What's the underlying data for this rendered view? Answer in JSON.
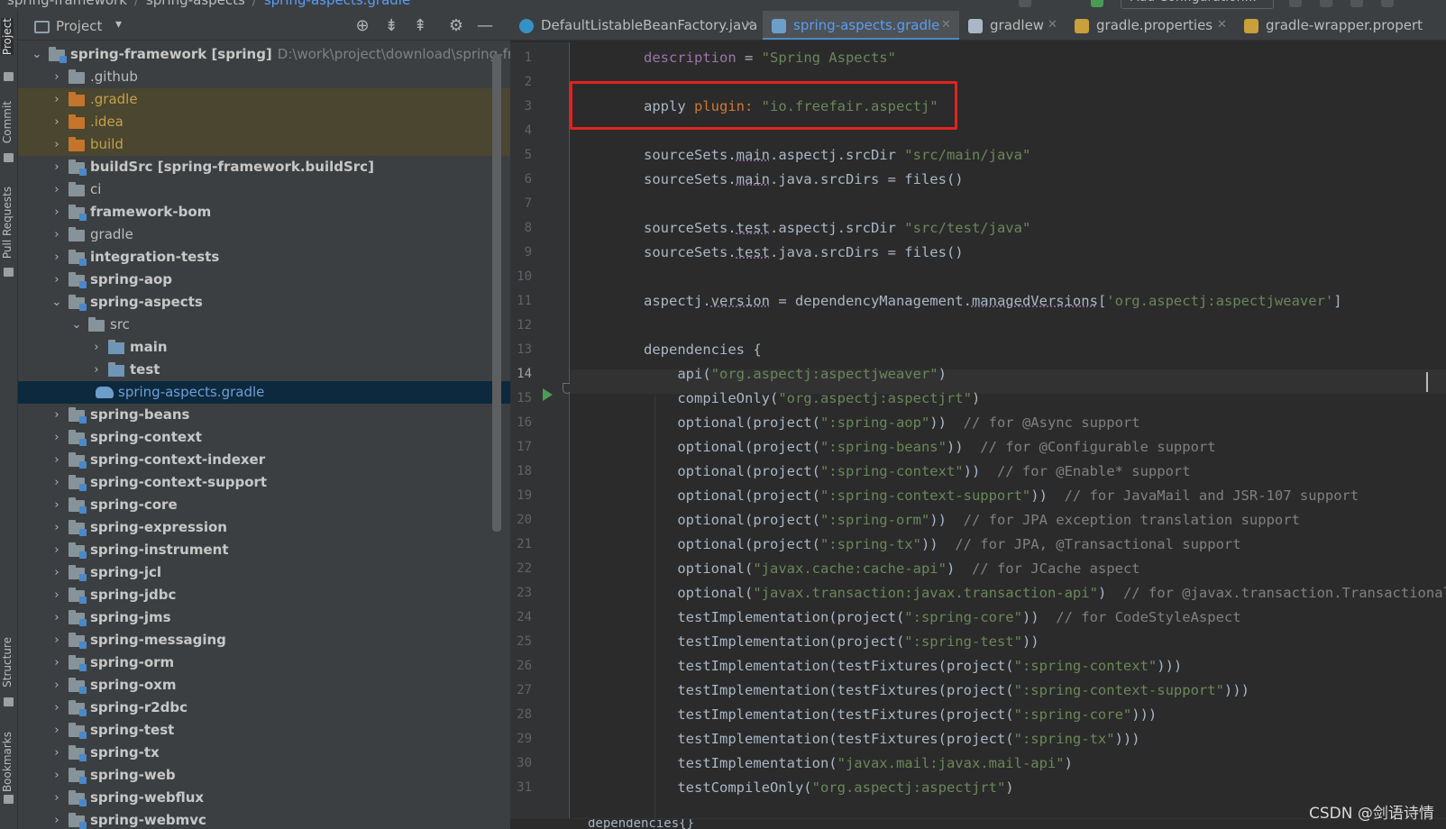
{
  "breadcrumb": [
    "spring-framework",
    "spring-aspects",
    "spring-aspects.gradle"
  ],
  "run_config": "Add Configuration...",
  "toolstrip": [
    "Project",
    "Commit",
    "Pull Requests",
    "Structure",
    "Bookmarks"
  ],
  "project_panel": {
    "title": "Project",
    "tree": [
      {
        "label": "spring-framework",
        "qualifier": "[spring]",
        "path": "D:\\work\\project\\download\\spring-frame",
        "level": 0,
        "expanded": true,
        "bold": true,
        "type": "module"
      },
      {
        "label": ".github",
        "level": 1,
        "type": "folder"
      },
      {
        "label": ".gradle",
        "level": 1,
        "type": "excluded"
      },
      {
        "label": ".idea",
        "level": 1,
        "type": "excluded"
      },
      {
        "label": "build",
        "level": 1,
        "type": "excluded"
      },
      {
        "label": "buildSrc",
        "qualifier": "[spring-framework.buildSrc]",
        "level": 1,
        "type": "module",
        "bold": true
      },
      {
        "label": "ci",
        "level": 1,
        "type": "folder"
      },
      {
        "label": "framework-bom",
        "level": 1,
        "type": "module",
        "bold": true
      },
      {
        "label": "gradle",
        "level": 1,
        "type": "folder"
      },
      {
        "label": "integration-tests",
        "level": 1,
        "type": "module",
        "bold": true
      },
      {
        "label": "spring-aop",
        "level": 1,
        "type": "module",
        "bold": true
      },
      {
        "label": "spring-aspects",
        "level": 1,
        "type": "module",
        "bold": true,
        "expanded": true
      },
      {
        "label": "src",
        "level": 2,
        "type": "folder",
        "expanded": true
      },
      {
        "label": "main",
        "level": 3,
        "type": "src",
        "bold": true
      },
      {
        "label": "test",
        "level": 3,
        "type": "src",
        "bold": true
      },
      {
        "label": "spring-aspects.gradle",
        "level": 3,
        "type": "gradle",
        "selected": true
      },
      {
        "label": "spring-beans",
        "level": 1,
        "type": "module",
        "bold": true
      },
      {
        "label": "spring-context",
        "level": 1,
        "type": "module",
        "bold": true
      },
      {
        "label": "spring-context-indexer",
        "level": 1,
        "type": "module",
        "bold": true
      },
      {
        "label": "spring-context-support",
        "level": 1,
        "type": "module",
        "bold": true
      },
      {
        "label": "spring-core",
        "level": 1,
        "type": "module",
        "bold": true
      },
      {
        "label": "spring-expression",
        "level": 1,
        "type": "module",
        "bold": true
      },
      {
        "label": "spring-instrument",
        "level": 1,
        "type": "module",
        "bold": true
      },
      {
        "label": "spring-jcl",
        "level": 1,
        "type": "module",
        "bold": true
      },
      {
        "label": "spring-jdbc",
        "level": 1,
        "type": "module",
        "bold": true
      },
      {
        "label": "spring-jms",
        "level": 1,
        "type": "module",
        "bold": true
      },
      {
        "label": "spring-messaging",
        "level": 1,
        "type": "module",
        "bold": true
      },
      {
        "label": "spring-orm",
        "level": 1,
        "type": "module",
        "bold": true
      },
      {
        "label": "spring-oxm",
        "level": 1,
        "type": "module",
        "bold": true
      },
      {
        "label": "spring-r2dbc",
        "level": 1,
        "type": "module",
        "bold": true
      },
      {
        "label": "spring-test",
        "level": 1,
        "type": "module",
        "bold": true
      },
      {
        "label": "spring-tx",
        "level": 1,
        "type": "module",
        "bold": true
      },
      {
        "label": "spring-web",
        "level": 1,
        "type": "module",
        "bold": true
      },
      {
        "label": "spring-webflux",
        "level": 1,
        "type": "module",
        "bold": true
      },
      {
        "label": "spring-webmvc",
        "level": 1,
        "type": "module",
        "bold": true
      }
    ]
  },
  "tabs": [
    {
      "label": "DefaultListableBeanFactory.java",
      "icon": "java-class-icon",
      "color": "#3592c4"
    },
    {
      "label": "spring-aspects.gradle",
      "icon": "gradle-icon",
      "color": "#6d9ec9",
      "active": true
    },
    {
      "label": "gradlew",
      "icon": "terminal-icon",
      "color": "#a9b7c6"
    },
    {
      "label": "gradle.properties",
      "icon": "properties-icon",
      "color": "#c9a03b"
    },
    {
      "label": "gradle-wrapper.propert",
      "icon": "properties-icon",
      "color": "#c9a03b"
    }
  ],
  "editor": {
    "current_line": 14,
    "lines": [
      "description = \"Spring Aspects\"",
      "",
      "apply plugin: \"io.freefair.aspectj\"",
      "",
      "sourceSets.main.aspectj.srcDir \"src/main/java\"",
      "sourceSets.main.java.srcDirs = files()",
      "",
      "sourceSets.test.aspectj.srcDir \"src/test/java\"",
      "sourceSets.test.java.srcDirs = files()",
      "",
      "aspectj.version = dependencyManagement.managedVersions['org.aspectj:aspectjweaver']",
      "",
      "dependencies {",
      "    api(\"org.aspectj:aspectjweaver\")",
      "    compileOnly(\"org.aspectj:aspectjrt\")",
      "    optional(project(\":spring-aop\"))  // for @Async support",
      "    optional(project(\":spring-beans\"))  // for @Configurable support",
      "    optional(project(\":spring-context\"))  // for @Enable* support",
      "    optional(project(\":spring-context-support\"))  // for JavaMail and JSR-107 support",
      "    optional(project(\":spring-orm\"))  // for JPA exception translation support",
      "    optional(project(\":spring-tx\"))  // for JPA, @Transactional support",
      "    optional(\"javax.cache:cache-api\")  // for JCache aspect",
      "    optional(\"javax.transaction:javax.transaction-api\")  // for @javax.transaction.Transactional",
      "    testImplementation(project(\":spring-core\"))  // for CodeStyleAspect",
      "    testImplementation(project(\":spring-test\"))",
      "    testImplementation(testFixtures(project(\":spring-context\")))",
      "    testImplementation(testFixtures(project(\":spring-context-support\")))",
      "    testImplementation(testFixtures(project(\":spring-core\")))",
      "    testImplementation(testFixtures(project(\":spring-tx\")))",
      "    testImplementation(\"javax.mail:javax.mail-api\")",
      "    testCompileOnly(\"org.aspectj:aspectjrt\")"
    ],
    "bottom_breadcrumb": "dependencies{}"
  },
  "annotation": {
    "color": "#e3231f",
    "highlighted_line": 3
  },
  "watermark": "CSDN @剑语诗情"
}
